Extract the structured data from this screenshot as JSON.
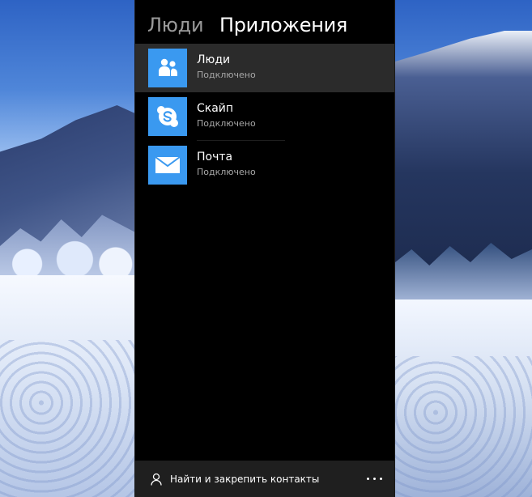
{
  "header": {
    "tabs": [
      {
        "label": "Люди",
        "active": false
      },
      {
        "label": "Приложения",
        "active": true
      }
    ]
  },
  "apps": [
    {
      "name": "Люди",
      "status": "Подключено",
      "icon": "people-icon",
      "selected": true
    },
    {
      "name": "Скайп",
      "status": "Подключено",
      "icon": "skype-icon",
      "selected": false
    },
    {
      "name": "Почта",
      "status": "Подключено",
      "icon": "mail-icon",
      "selected": false
    }
  ],
  "footer": {
    "find_label": "Найти и закрепить контакты",
    "find_icon": "person-icon",
    "more_icon": "more-dots-icon"
  },
  "colors": {
    "panel_bg": "#000000",
    "tile_accent": "#3a99f0",
    "selected_row": "#2b2b2b",
    "footer_bg": "#1f1f1f",
    "inactive_tab": "#9a9a9a"
  }
}
